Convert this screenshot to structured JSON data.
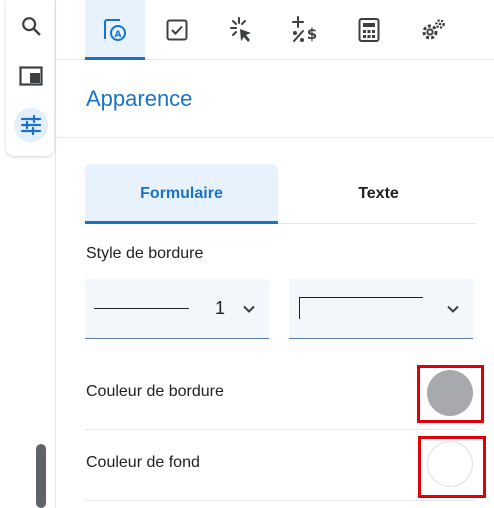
{
  "rail": {
    "items": [
      {
        "icon": "search-icon"
      },
      {
        "icon": "panel-icon"
      },
      {
        "icon": "sliders-icon",
        "active": true
      }
    ]
  },
  "toolbar": {
    "tabs": [
      {
        "icon": "appearance-icon",
        "active": true
      },
      {
        "icon": "checkbox-icon"
      },
      {
        "icon": "cursor-click-icon"
      },
      {
        "icon": "number-format-icon"
      },
      {
        "icon": "calculator-icon"
      },
      {
        "icon": "gear-icon"
      }
    ]
  },
  "panel": {
    "title": "Apparence",
    "subtabs": [
      {
        "label": "Formulaire",
        "active": true
      },
      {
        "label": "Texte",
        "active": false
      }
    ],
    "border_style": {
      "label": "Style de bordure",
      "width_value": "1"
    },
    "border_color": {
      "label": "Couleur de bordure",
      "color": "#a8a9ad"
    },
    "background_color": {
      "label": "Couleur de fond",
      "color": "#ffffff"
    }
  },
  "colors": {
    "accent": "#1a73c8",
    "highlight": "#e0000c"
  }
}
